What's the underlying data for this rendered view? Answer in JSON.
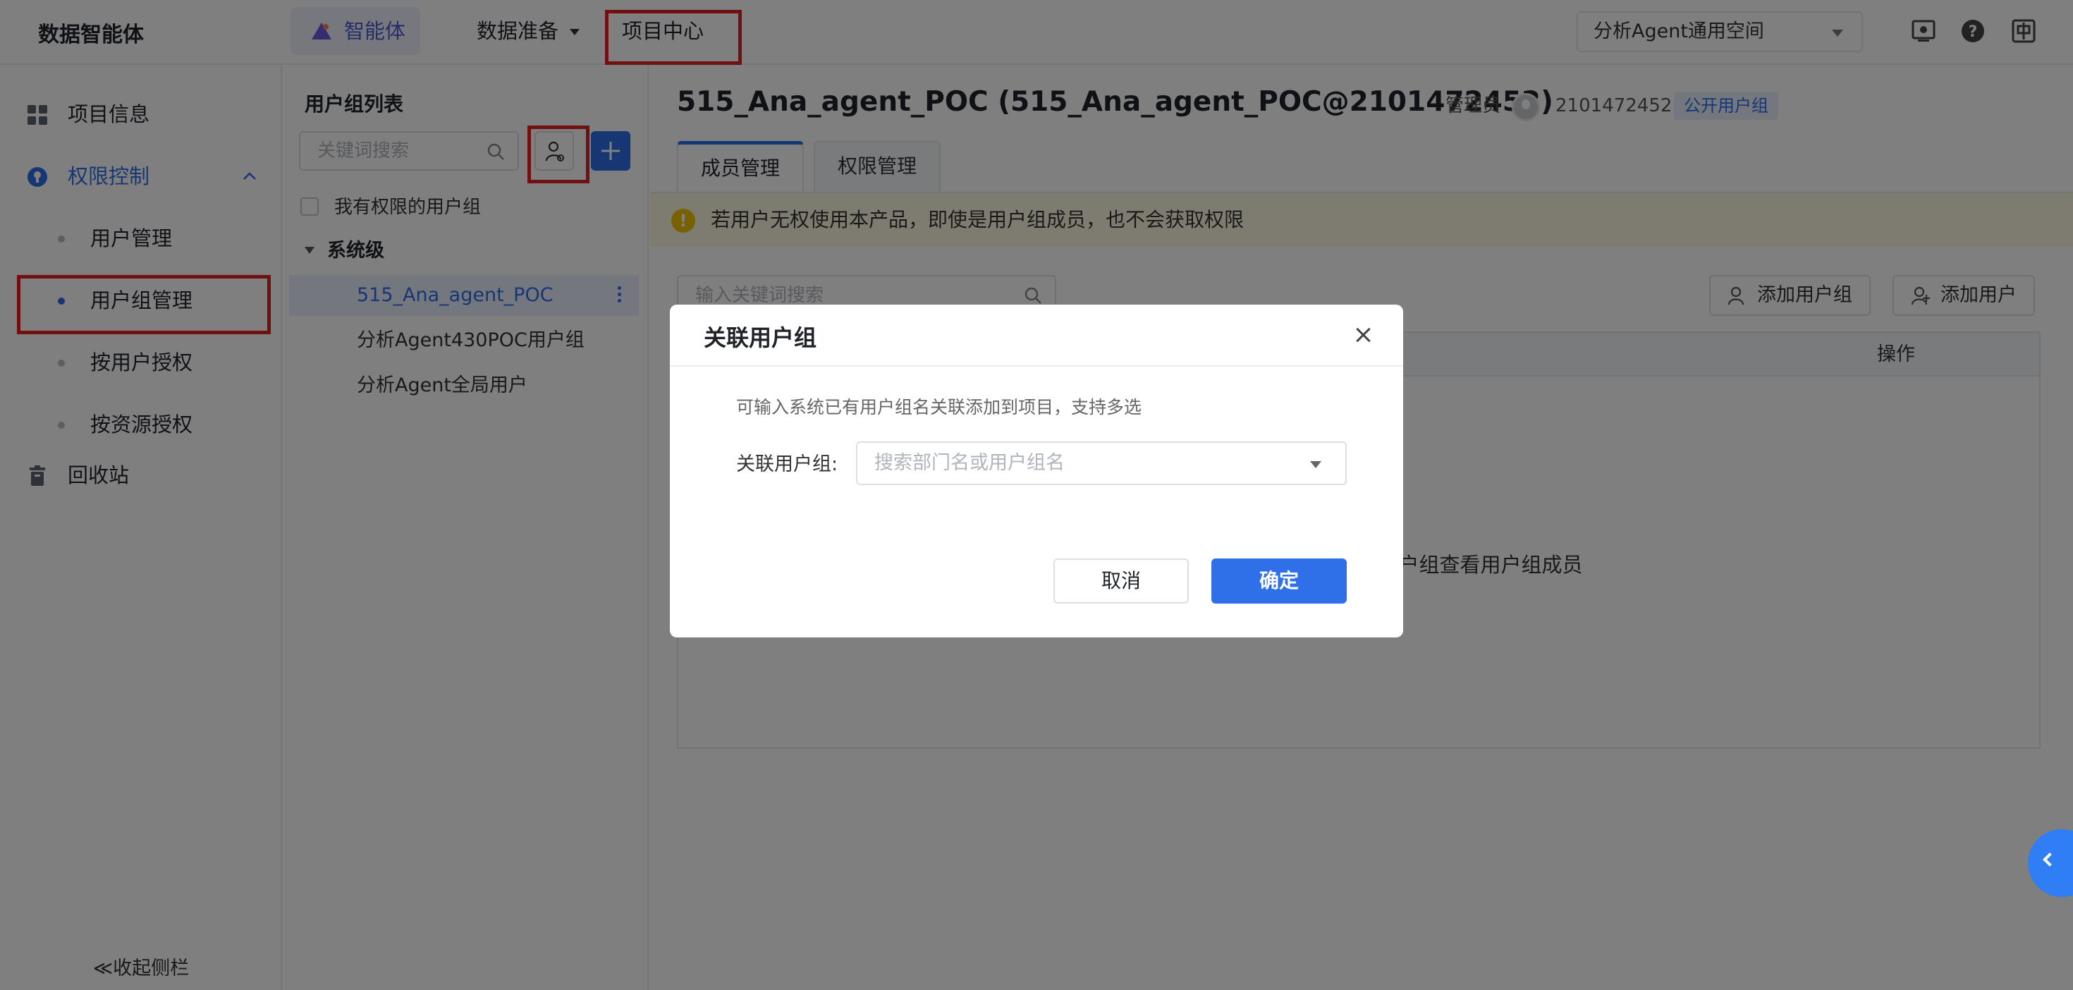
{
  "brand": "数据智能体",
  "nav": {
    "agent": "智能体",
    "data_prep": "数据准备",
    "project_center": "项目中心"
  },
  "space_select": "分析Agent通用空间",
  "sidebar": {
    "project_info": "项目信息",
    "permission_control": "权限控制",
    "user_management": "用户管理",
    "group_management": "用户组管理",
    "auth_by_user": "按用户授权",
    "auth_by_resource": "按资源授权",
    "recycle_bin": "回收站",
    "collapse": "≪收起侧栏"
  },
  "group_panel": {
    "title": "用户组列表",
    "search_placeholder": "关键词搜索",
    "my_groups": "我有权限的用户组",
    "tree_head": "系统级",
    "items": [
      "515_Ana_agent_POC",
      "分析Agent430POC用户组",
      "分析Agent全局用户"
    ]
  },
  "main": {
    "title": "515_Ana_agent_POC (515_Ana_agent_POC@2101472452)",
    "role_label": "管理员",
    "user_id": "2101472452",
    "badge": "公开用户组",
    "tabs": [
      "成员管理",
      "权限管理"
    ],
    "warning": "若用户无权使用本产品，即使是用户组成员，也不会获取权限",
    "search_placeholder": "输入关键词搜索",
    "add_group_button": "添加用户组",
    "add_user_button": "添加用户",
    "col_action": "操作",
    "empty_hint": "-用户组查看用户组成员"
  },
  "modal": {
    "title": "关联用户组",
    "desc": "可输入系统已有用户组名关联添加到项目，支持多选",
    "field_label": "关联用户组:",
    "select_placeholder": "搜索部门名或用户组名",
    "cancel": "取消",
    "confirm": "确定"
  },
  "colors": {
    "accent": "#2f6fe8",
    "highlight_box": "#e02020",
    "warning_bg": "#fdf6e0",
    "warning_icon": "#f2c200"
  },
  "icons": [
    "grid-icon",
    "shield-icon",
    "trash-icon",
    "search-icon",
    "link-user-icon",
    "plus-icon",
    "more-icon",
    "user-add-icon",
    "avatar-icon",
    "close-icon",
    "warning-icon",
    "chevron-left-icon",
    "screen-icon",
    "help-icon",
    "language-icon"
  ]
}
